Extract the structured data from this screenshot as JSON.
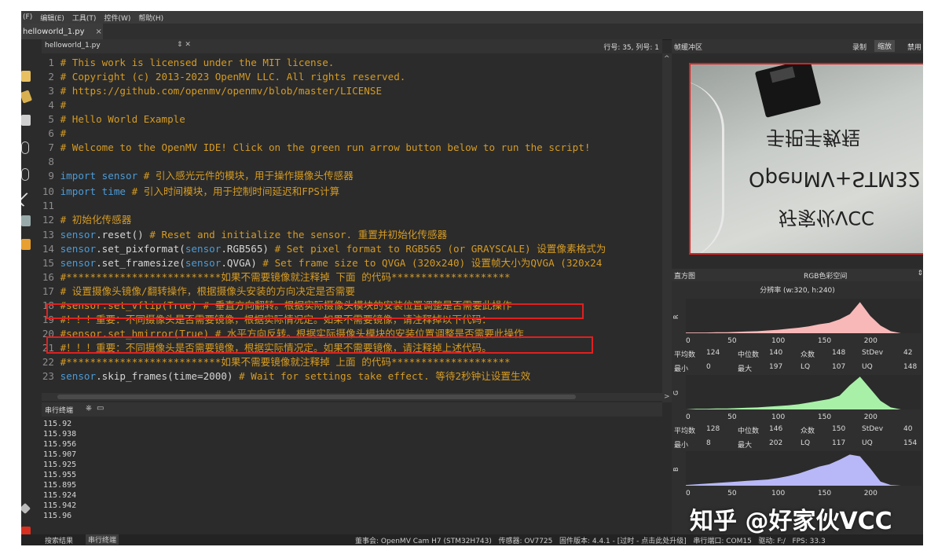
{
  "menubar": {
    "items": [
      "(F)",
      "编辑(E)",
      "工具(T)",
      "控件(W)",
      "帮助(H)"
    ]
  },
  "file_tab": {
    "label": "helloworld_1.py",
    "close": "×"
  },
  "editor": {
    "filename": "helloworld_1.py",
    "ctrl": "⇕ ✕",
    "position": "行号: 35, 列号: 1",
    "lines": [
      {
        "n": "1",
        "parts": [
          {
            "c": "cm",
            "t": "# This work is licensed under the MIT license."
          }
        ]
      },
      {
        "n": "2",
        "parts": [
          {
            "c": "cm",
            "t": "# Copyright (c) 2013-2023 OpenMV LLC. All rights reserved."
          }
        ]
      },
      {
        "n": "3",
        "parts": [
          {
            "c": "cm",
            "t": "# https://github.com/openmv/openmv/blob/master/LICENSE"
          }
        ]
      },
      {
        "n": "4",
        "parts": [
          {
            "c": "cm",
            "t": "#"
          }
        ]
      },
      {
        "n": "5",
        "parts": [
          {
            "c": "cm",
            "t": "# Hello World Example"
          }
        ]
      },
      {
        "n": "6",
        "parts": [
          {
            "c": "cm",
            "t": "#"
          }
        ]
      },
      {
        "n": "7",
        "parts": [
          {
            "c": "cm",
            "t": "# Welcome to the OpenMV IDE! Click on the green run arrow button below to run the script!"
          }
        ]
      },
      {
        "n": "8",
        "parts": []
      },
      {
        "n": "9",
        "parts": [
          {
            "c": "kw",
            "t": "import sensor "
          },
          {
            "c": "cm",
            "t": "# 引入感光元件的模块，用于操作摄像头传感器"
          }
        ]
      },
      {
        "n": "10",
        "parts": [
          {
            "c": "kw",
            "t": "import time "
          },
          {
            "c": "cm",
            "t": "# 引入时间模块，用于控制时间延迟和FPS计算"
          }
        ]
      },
      {
        "n": "11",
        "parts": []
      },
      {
        "n": "12",
        "parts": [
          {
            "c": "cm",
            "t": "# 初始化传感器"
          }
        ]
      },
      {
        "n": "13",
        "parts": [
          {
            "c": "kw",
            "t": "sensor"
          },
          {
            "c": "plain",
            "t": ".reset()  "
          },
          {
            "c": "cm",
            "t": "# Reset and initialize the sensor. 重置并初始化传感器"
          }
        ]
      },
      {
        "n": "14",
        "parts": [
          {
            "c": "kw",
            "t": "sensor"
          },
          {
            "c": "plain",
            "t": ".set_pixformat("
          },
          {
            "c": "kw",
            "t": "sensor"
          },
          {
            "c": "plain",
            "t": ".RGB565)  "
          },
          {
            "c": "cm",
            "t": "# Set pixel format to RGB565 (or GRAYSCALE) 设置像素格式为"
          }
        ]
      },
      {
        "n": "15",
        "parts": [
          {
            "c": "kw",
            "t": "sensor"
          },
          {
            "c": "plain",
            "t": ".set_framesize("
          },
          {
            "c": "kw",
            "t": "sensor"
          },
          {
            "c": "plain",
            "t": ".QVGA)  "
          },
          {
            "c": "cm",
            "t": "# Set frame size to QVGA (320x240) 设置帧大小为QVGA (320x24"
          }
        ]
      },
      {
        "n": "16",
        "parts": [
          {
            "c": "cm",
            "t": "#**************************如果不需要镜像就注释掉 下面 的代码********************"
          }
        ]
      },
      {
        "n": "17",
        "parts": [
          {
            "c": "cm",
            "t": "# 设置摄像头镜像/翻转操作，根据摄像头安装的方向决定是否需要"
          }
        ]
      },
      {
        "n": "18",
        "parts": [
          {
            "c": "cm",
            "t": "#sensor.set_vflip(True)  # 垂直方向翻转。根据实际摄像头模块的安装位置调整是否需要此操作"
          }
        ]
      },
      {
        "n": "19",
        "parts": [
          {
            "c": "cm",
            "t": "#！！！重要：不同摄像头是否需要镜像，根据实际情况定。如果不需要镜像，请注释掉以下代码："
          }
        ]
      },
      {
        "n": "20",
        "parts": [
          {
            "c": "cm",
            "t": "#sensor.set_hmirror(True)  # 水平方向反转。根据实际摄像头模块的安装位置调整是否需要此操作"
          }
        ]
      },
      {
        "n": "21",
        "parts": [
          {
            "c": "cm",
            "t": "#！！！重要：不同摄像头是否需要镜像，根据实际情况定。如果不需要镜像，请注释掉上述代码。"
          }
        ]
      },
      {
        "n": "22",
        "parts": [
          {
            "c": "cm",
            "t": "#**************************如果不需要镜像就注释掉 上面 的代码********************"
          }
        ]
      },
      {
        "n": "23",
        "parts": [
          {
            "c": "kw",
            "t": "sensor"
          },
          {
            "c": "plain",
            "t": ".skip_frames(time=2000)  "
          },
          {
            "c": "cm",
            "t": "# Wait for settings take effect. 等待2秒钟让设置生效"
          }
        ]
      }
    ]
  },
  "terminal": {
    "title": "串行终端",
    "lines": [
      "115.92",
      "115.938",
      "115.956",
      "115.907",
      "115.925",
      "115.955",
      "115.895",
      "115.924",
      "115.942",
      "115.96"
    ]
  },
  "status": {
    "tab_search": "搜索结果",
    "tab_terminal": "串行终端",
    "board": "董事会: OpenMV Cam H7 (STM32H743)",
    "sensor": "传感器: OV7725",
    "firmware": "固件版本: 4.4.1 - [过时 - 点击此处升级]",
    "port": "串行端口: COM15",
    "drive": "驱动: F:/",
    "fps": "FPS: 33.3"
  },
  "framebuffer": {
    "title": "帧缓冲区",
    "btn_record": "录制",
    "btn_zoom": "缩放",
    "btn_disable": "禁用",
    "photo_text": {
      "line1": "手把手教程",
      "line2": "OpenMV+STM32",
      "line3": "好家伙VCC"
    }
  },
  "histogram": {
    "title": "直方图",
    "mode": "RGB色彩空间",
    "mode_arrow": "⇕",
    "resolution": "分辨率 (w:320, h:240)",
    "ticks": [
      "0",
      "50",
      "100",
      "150",
      "200"
    ],
    "labels": {
      "mean": "平均数",
      "median": "中位数",
      "mode": "众数",
      "stdev": "StDev",
      "min": "最小",
      "max": "最大",
      "lq": "LQ",
      "uq": "UQ"
    },
    "channels": [
      {
        "axis": "R",
        "color": "#f8b8b8",
        "mean": "124",
        "median": "140",
        "mode": "148",
        "stdev": "42",
        "min": "0",
        "max": "197",
        "lq": "107",
        "uq": "148",
        "profile": [
          0.02,
          0.02,
          0.02,
          0.03,
          0.03,
          0.04,
          0.05,
          0.06,
          0.08,
          0.1,
          0.13,
          0.16,
          0.2,
          0.26,
          0.3,
          0.4,
          0.55,
          0.9,
          0.5,
          0.22,
          0.06,
          0.0,
          0.0,
          0.0
        ]
      },
      {
        "axis": "G",
        "color": "#a8f0a8",
        "mean": "128",
        "median": "146",
        "mode": "150",
        "stdev": "40",
        "min": "8",
        "max": "202",
        "lq": "117",
        "uq": "154",
        "profile": [
          0.0,
          0.02,
          0.02,
          0.03,
          0.03,
          0.04,
          0.05,
          0.06,
          0.08,
          0.1,
          0.12,
          0.15,
          0.2,
          0.25,
          0.3,
          0.4,
          0.7,
          0.95,
          0.6,
          0.25,
          0.06,
          0.0,
          0.0,
          0.0
        ]
      },
      {
        "axis": "B",
        "color": "#b8b8f8",
        "mean": "",
        "median": "",
        "mode": "",
        "stdev": "",
        "min": "",
        "max": "",
        "lq": "",
        "uq": "",
        "profile": [
          0.02,
          0.04,
          0.06,
          0.08,
          0.1,
          0.12,
          0.14,
          0.16,
          0.18,
          0.22,
          0.28,
          0.35,
          0.45,
          0.55,
          0.62,
          0.75,
          0.9,
          0.85,
          0.5,
          0.12,
          0.02,
          0.0,
          0.0,
          0.0
        ]
      }
    ]
  },
  "watermark": "知乎 @好家伙VCC",
  "colors": {
    "comment": "#d59b24",
    "keyword": "#4c9bd6",
    "highlight": "#e02020",
    "background": "#2b2b2b"
  }
}
